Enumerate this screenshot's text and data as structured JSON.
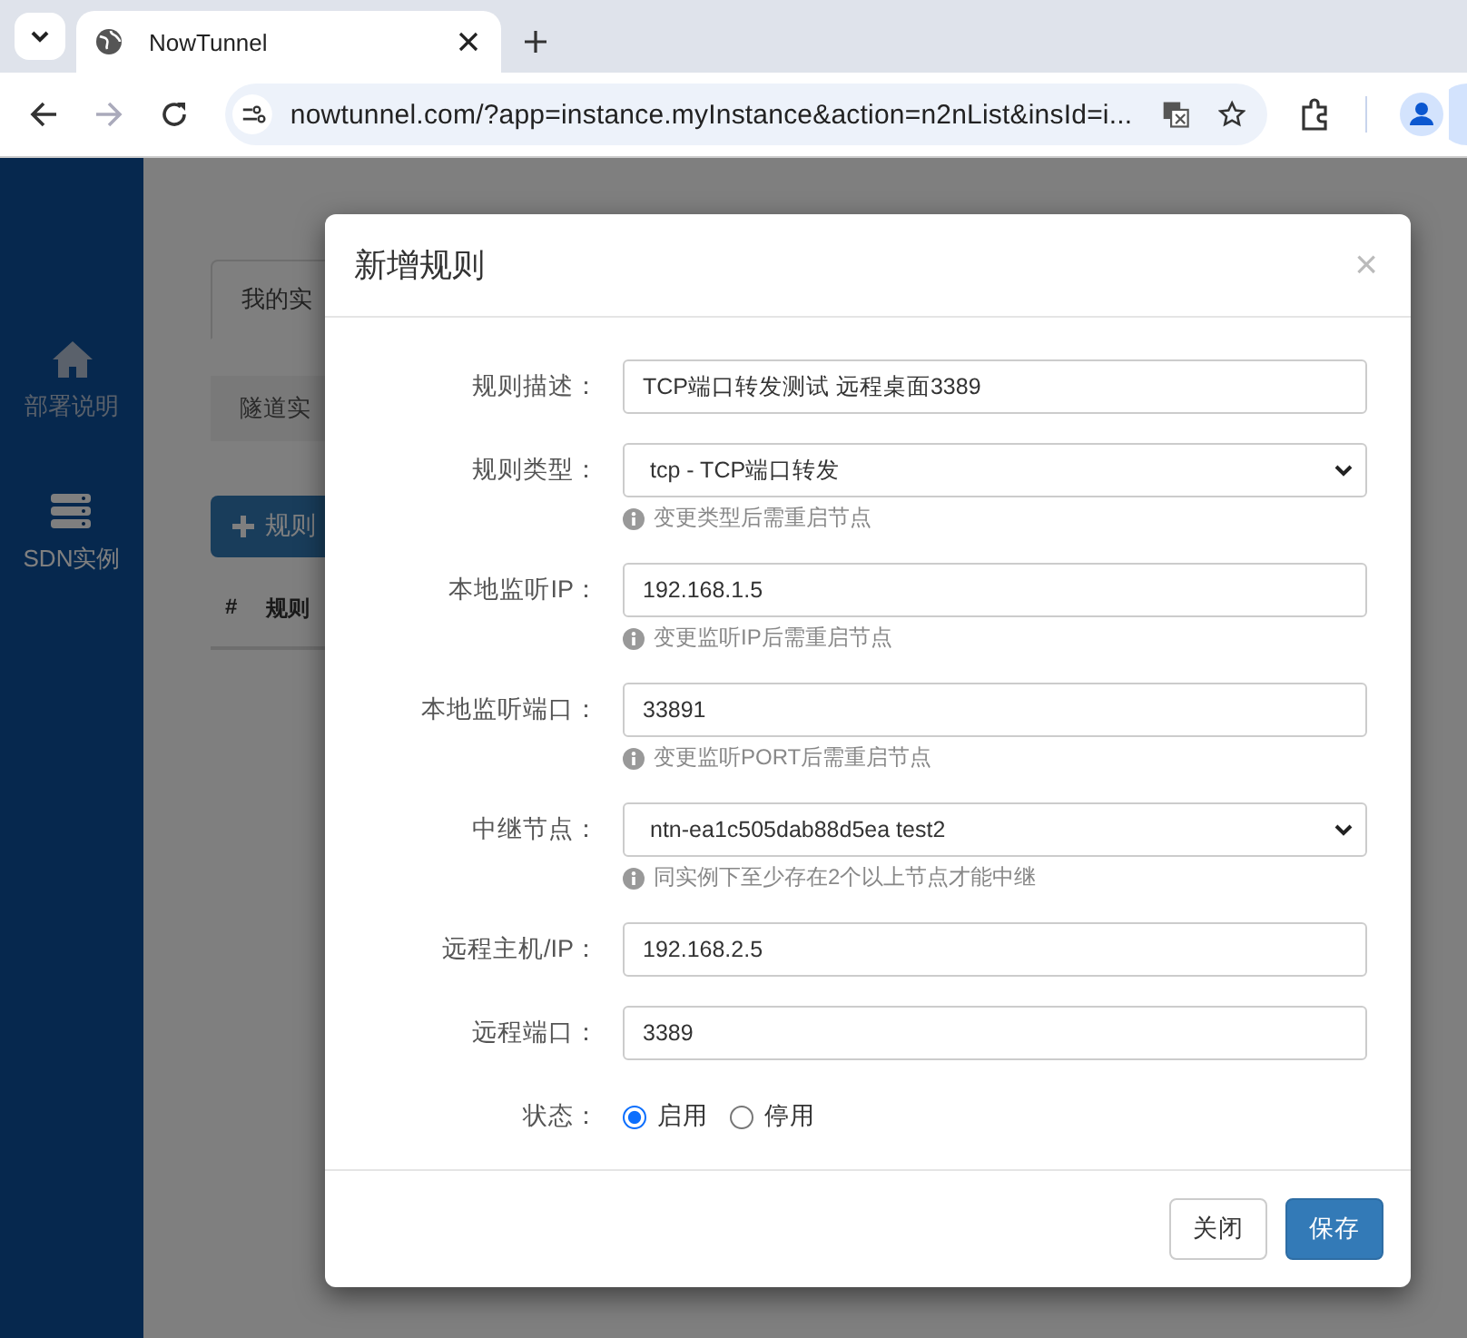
{
  "browser": {
    "tab": {
      "title": "NowTunnel"
    },
    "address": "nowtunnel.com/?app=instance.myInstance&action=n2nList&insId=i...",
    "forward_disabled": true
  },
  "sidebar": {
    "items": [
      {
        "label": "部署说明",
        "kind": "home",
        "selected": false
      },
      {
        "label": "SDN实例",
        "kind": "server",
        "selected": true
      }
    ]
  },
  "page": {
    "tabs": [
      {
        "label": "我的实",
        "selected": true
      }
    ],
    "panel_title": "隧道实",
    "add_button": "规则",
    "table": {
      "columns": [
        "#",
        "规则"
      ]
    }
  },
  "dialog": {
    "title": "新增规则",
    "close": "×",
    "fields": [
      {
        "kind": "text",
        "label": "规则描述：",
        "value": "TCP端口转发测试 远程桌面3389"
      },
      {
        "kind": "select",
        "label": "规则类型：",
        "value": "tcp - TCP端口转发",
        "hint": "变更类型后需重启节点"
      },
      {
        "kind": "text",
        "label": "本地监听IP：",
        "value": "192.168.1.5",
        "hint": "变更监听IP后需重启节点"
      },
      {
        "kind": "text",
        "label": "本地监听端口：",
        "value": "33891",
        "hint": "变更监听PORT后需重启节点"
      },
      {
        "kind": "select",
        "label": "中继节点：",
        "value": "ntn-ea1c505dab88d5ea test2",
        "hint": "同实例下至少存在2个以上节点才能中继"
      },
      {
        "kind": "text",
        "label": "远程主机/IP：",
        "value": "192.168.2.5"
      },
      {
        "kind": "text",
        "label": "远程端口：",
        "value": "3389"
      },
      {
        "kind": "radio",
        "label": "状态：",
        "options": [
          {
            "label": "启用",
            "selected": true
          },
          {
            "label": "停用",
            "selected": false
          }
        ]
      }
    ],
    "buttons": [
      {
        "label": "关闭",
        "kind": "default"
      },
      {
        "label": "保存",
        "kind": "primary"
      }
    ]
  }
}
